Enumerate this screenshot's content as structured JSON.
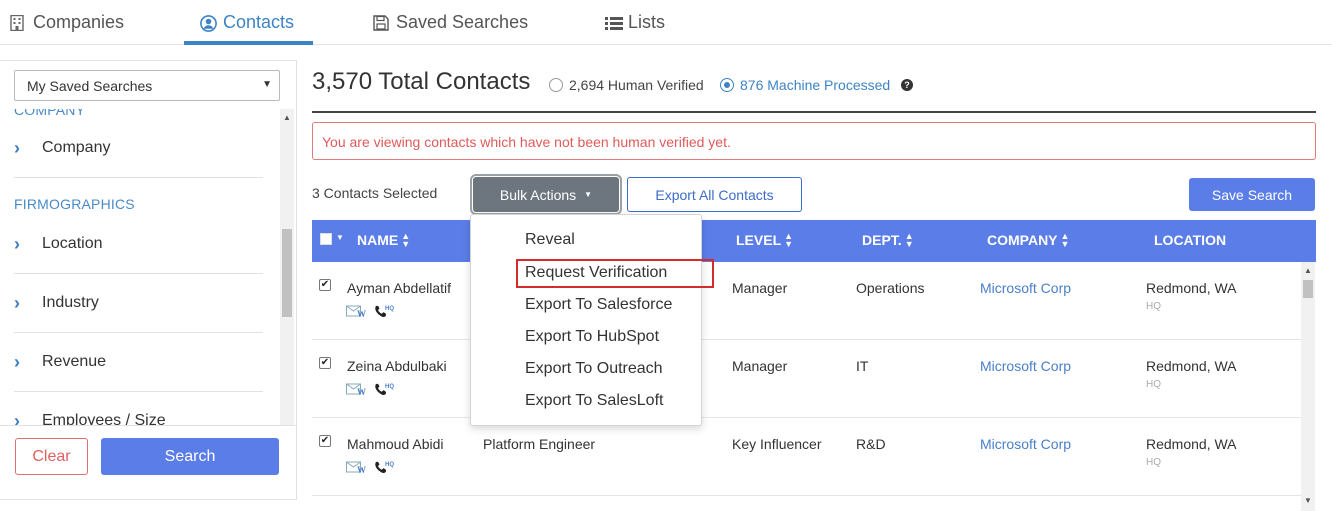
{
  "nav": {
    "tabs": [
      {
        "label": "Companies",
        "icon": "building-icon"
      },
      {
        "label": "Contacts",
        "icon": "user-circle-icon",
        "active": true
      },
      {
        "label": "Saved Searches",
        "icon": "floppy-disk-icon"
      },
      {
        "label": "Lists",
        "icon": "list-icon"
      }
    ]
  },
  "sidebar": {
    "saved_select": "My Saved Searches",
    "section_cut": "COMPANY",
    "section_firmographics": "FIRMOGRAPHICS",
    "items": [
      "Company",
      "Location",
      "Industry",
      "Revenue",
      "Employees / Size"
    ],
    "clear_label": "Clear",
    "search_label": "Search"
  },
  "main": {
    "total_title": "3,570 Total Contacts",
    "human_verified": "2,694 Human Verified",
    "machine_processed": "876 Machine Processed",
    "alert": "You are viewing contacts which have not been human verified yet.",
    "selected_count": "3 Contacts Selected",
    "bulk_actions": "Bulk Actions",
    "export_all": "Export All Contacts",
    "save_search": "Save Search"
  },
  "table": {
    "headers": {
      "name": "NAME",
      "level": "LEVEL",
      "dept": "DEPT.",
      "company": "COMPANY",
      "location": "LOCATION"
    },
    "rows": [
      {
        "name": "Ayman Abdellatif",
        "title": "",
        "level": "Manager",
        "dept": "Operations",
        "company": "Microsoft Corp",
        "location": "Redmond, WA",
        "loc_tag": "HQ",
        "checked": true
      },
      {
        "name": "Zeina Abdulbaki",
        "title": "",
        "level": "Manager",
        "dept": "IT",
        "company": "Microsoft Corp",
        "location": "Redmond, WA",
        "loc_tag": "HQ",
        "checked": true
      },
      {
        "name": "Mahmoud Abidi",
        "title": "Platform Engineer",
        "level": "Key Influencer",
        "dept": "R&D",
        "company": "Microsoft Corp",
        "location": "Redmond, WA",
        "loc_tag": "HQ",
        "checked": true
      }
    ],
    "row_icon_badge": "HQ"
  },
  "menu": {
    "items": [
      "Reveal",
      "Request Verification",
      "Export To Salesforce",
      "Export To HubSpot",
      "Export To Outreach",
      "Export To SalesLoft"
    ]
  },
  "colors": {
    "accent": "#5b7de8",
    "link": "#3d84c7",
    "alert": "#e05a5a",
    "highlight": "#d62b2b"
  }
}
